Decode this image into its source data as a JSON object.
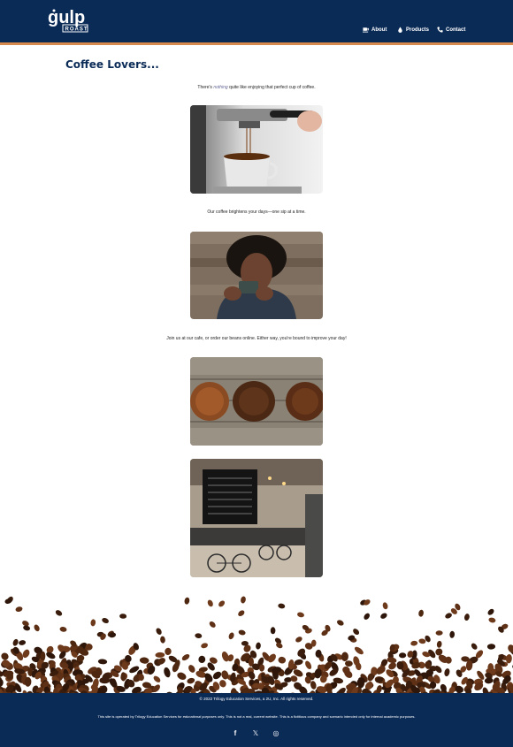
{
  "header": {
    "logo_text": "gulp",
    "logo_subtext": "ROAST",
    "nav": [
      {
        "label": "About",
        "icon": "coffee-cup-icon"
      },
      {
        "label": "Products",
        "icon": "drop-icon"
      },
      {
        "label": "Contact",
        "icon": "phone-icon"
      }
    ]
  },
  "main": {
    "title": "Coffee Lovers...",
    "caption1_pre": "There's ",
    "caption1_em": "nothing",
    "caption1_post": " quite like enjoying that perfect cup of coffee.",
    "caption2": "Our coffee brightens your days—one sip at a time.",
    "caption3": "Join us at our cafe, or order our beans online. Either way, you're bound to improve your day!"
  },
  "footer": {
    "copyright": "© 2022 Trilogy Education Services, a 2U, Inc. All rights reserved.",
    "note_pre": "This site is operated by Trilogy Education Services for ",
    "note_em": "educational purposes",
    "note_post": " only. This is not a real, current website. This is a fictitious company and scenario intended only for internal academic purposes.",
    "social": [
      {
        "icon": "facebook-icon",
        "glyph": "f"
      },
      {
        "icon": "x-icon",
        "glyph": "𝕏"
      },
      {
        "icon": "instagram-icon",
        "glyph": "◎"
      }
    ]
  },
  "colors": {
    "brand_navy": "#0b2b57",
    "accent_orange": "#d88a4c"
  }
}
